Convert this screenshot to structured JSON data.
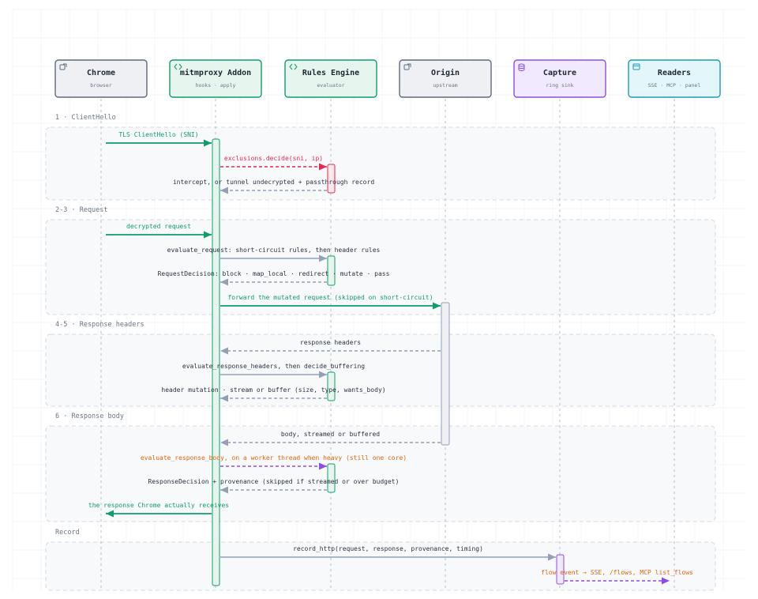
{
  "participants": [
    {
      "id": "chrome",
      "name": "Chrome",
      "subtitle": "browser",
      "icon": "window-icon",
      "kind": "gray"
    },
    {
      "id": "addon",
      "name": "mitmproxy Addon",
      "subtitle": "hooks · apply",
      "icon": "code-icon",
      "kind": "green"
    },
    {
      "id": "rules",
      "name": "Rules Engine",
      "subtitle": "evaluator",
      "icon": "code-icon",
      "kind": "green"
    },
    {
      "id": "origin",
      "name": "Origin",
      "subtitle": "upstream",
      "icon": "window-icon",
      "kind": "gray"
    },
    {
      "id": "capture",
      "name": "Capture",
      "subtitle": "ring sink",
      "icon": "database-icon",
      "kind": "purple"
    },
    {
      "id": "readers",
      "name": "Readers",
      "subtitle": "SSE · MCP · panel",
      "icon": "browser-icon",
      "kind": "cyan"
    }
  ],
  "sections": [
    {
      "label": "1 · ClientHello"
    },
    {
      "label": "2-3 · Request"
    },
    {
      "label": "4-5 · Response headers"
    },
    {
      "label": "6 · Response body"
    },
    {
      "label": "Record"
    }
  ],
  "messages": [
    {
      "from": "chrome",
      "to": "addon",
      "label": "TLS ClientHello (SNI)",
      "style": "solid",
      "color": "green"
    },
    {
      "from": "addon",
      "to": "rules",
      "label": "exclusions.decide(sni, ip)",
      "style": "dashed",
      "color": "red"
    },
    {
      "from": "rules",
      "to": "addon",
      "label": "intercept, or tunnel undecrypted + passthrough record",
      "style": "dashed",
      "color": "gray"
    },
    {
      "from": "chrome",
      "to": "addon",
      "label": "decrypted request",
      "style": "solid",
      "color": "green"
    },
    {
      "from": "addon",
      "to": "rules",
      "label": "evaluate_request: short-circuit rules, then header rules",
      "style": "solid",
      "color": "gray"
    },
    {
      "from": "rules",
      "to": "addon",
      "label": "RequestDecision: block · map_local · redirect · mutate · pass",
      "style": "dashed",
      "color": "gray"
    },
    {
      "from": "addon",
      "to": "origin",
      "label": "forward the mutated request (skipped on short-circuit)",
      "style": "solid",
      "color": "green"
    },
    {
      "from": "origin",
      "to": "addon",
      "label": "response headers",
      "style": "dashed",
      "color": "gray"
    },
    {
      "from": "addon",
      "to": "rules",
      "label": "evaluate_response_headers, then decide_buffering",
      "style": "solid",
      "color": "gray"
    },
    {
      "from": "rules",
      "to": "addon",
      "label": "header mutation · stream or buffer (size, type, wants_body)",
      "style": "dashed",
      "color": "gray"
    },
    {
      "from": "origin",
      "to": "addon",
      "label": "body, streamed or buffered",
      "style": "dashed",
      "color": "gray"
    },
    {
      "from": "addon",
      "to": "rules",
      "label": "evaluate_response_body, on a worker thread when heavy (still one core)",
      "style": "dashed",
      "color": "purple",
      "label_color": "orange"
    },
    {
      "from": "rules",
      "to": "addon",
      "label": "ResponseDecision + provenance (skipped if streamed or over budget)",
      "style": "dashed",
      "color": "gray"
    },
    {
      "from": "addon",
      "to": "chrome",
      "label": "the response Chrome actually receives",
      "style": "solid",
      "color": "green"
    },
    {
      "from": "addon",
      "to": "capture",
      "label": "record_http(request, response, provenance, timing)",
      "style": "solid",
      "color": "gray"
    },
    {
      "from": "capture",
      "to": "readers",
      "label": "flow event → SSE, /flows, MCP list_flows",
      "style": "dashed",
      "color": "purple",
      "label_color": "orange"
    }
  ],
  "colors": {
    "green": "#0f9d6b",
    "green_fill": "#e6f6ef",
    "gray": "#94a0b4",
    "gray_fill": "#eef0f4",
    "gray_stroke": "#5f6b7a",
    "red": "#e5294f",
    "red_fill": "#fde8ee",
    "purple": "#8a4ee8",
    "purple_fill": "#f1e9fd",
    "cyan": "#1d9bb3",
    "cyan_fill": "#e3f6fa",
    "orange": "#e2660e",
    "text": "#2b3340",
    "muted": "#6b7585"
  }
}
